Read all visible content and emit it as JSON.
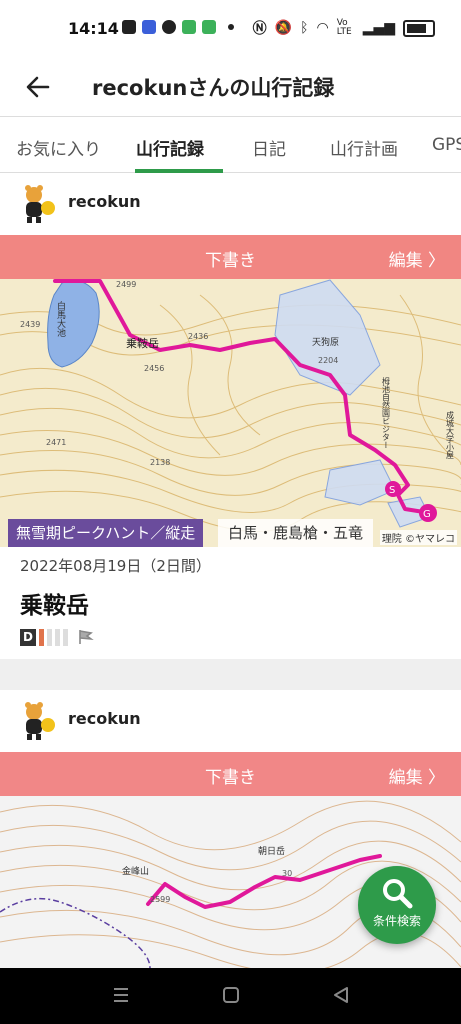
{
  "status": {
    "time": "14:14",
    "network_label": "Vo LTE"
  },
  "header": {
    "title": "recokunさんの山行記録"
  },
  "tabs": [
    {
      "label": "お気に入り"
    },
    {
      "label": "山行記録"
    },
    {
      "label": "日記"
    },
    {
      "label": "山行計画"
    },
    {
      "label": "GPS"
    }
  ],
  "records": [
    {
      "user": "recokun",
      "draft_label": "下書き",
      "edit_label": "編集 〉",
      "tag": "無雪期ピークハント／縦走",
      "region": "白馬・鹿島槍・五竜",
      "copyright": "理院 ©ヤマレコ",
      "date": "2022年08月19日（2日間）",
      "title": "乗鞍岳",
      "level_letter": "D",
      "map_labels": {
        "pond": "白馬大池",
        "peak": "乗鞍岳",
        "area": "天狗原",
        "h1": "2436",
        "h2": "2204",
        "h3": "2456",
        "h4": "2471",
        "h5": "2138",
        "h6": "2439",
        "h7": "2499",
        "facility": "栂池自然園ビジター",
        "lodge": "成城大学小屋"
      }
    },
    {
      "user": "recokun",
      "draft_label": "下書き",
      "edit_label": "編集 〉",
      "map_labels": {
        "peak1": "金峰山",
        "peak2": "朝日岳",
        "h1": "2599",
        "h2": "30"
      }
    }
  ],
  "fab": {
    "label": "条件検索"
  },
  "colors": {
    "accent": "#2e9b4a",
    "track": "#e0189a",
    "draft": "#f07878",
    "tag": "#6a4c9c"
  }
}
